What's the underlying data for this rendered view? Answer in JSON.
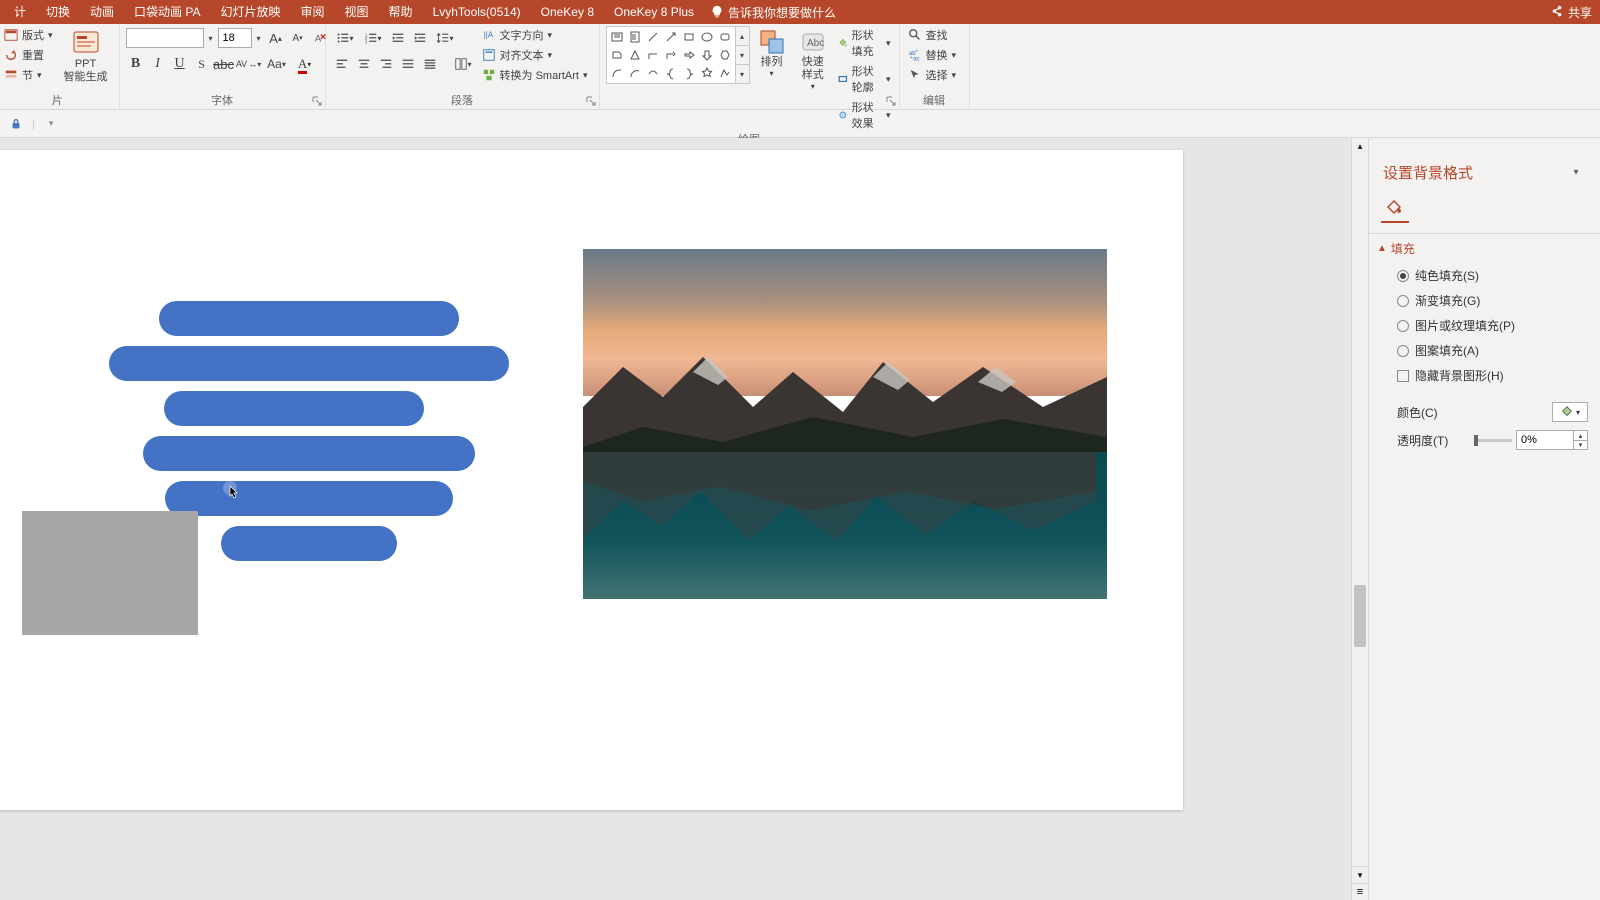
{
  "ribbon_tabs": {
    "design": "计",
    "transitions": "切换",
    "animations": "动画",
    "pocket_anim": "口袋动画 PA",
    "slideshow": "幻灯片放映",
    "review": "审阅",
    "view": "视图",
    "help": "帮助",
    "lvyh": "LvyhTools(0514)",
    "onekey8": "OneKey 8",
    "onekey8plus": "OneKey 8 Plus",
    "tell_me": "告诉我你想要做什么",
    "share": "共享"
  },
  "ribbon": {
    "slides": {
      "layout": "版式",
      "reset": "重置",
      "section": "节",
      "ppt_ai": "PPT\n智能生成"
    },
    "font": {
      "size": "18",
      "label": "字体",
      "spacing": "AV",
      "aa": "Aa"
    },
    "paragraph": {
      "label": "段落",
      "direction": "文字方向",
      "align_text": "对齐文本",
      "smartart": "转换为 SmartArt"
    },
    "drawing": {
      "label": "绘图",
      "arrange": "排列",
      "quick_styles": "快速样式",
      "shape_fill": "形状填充",
      "shape_outline": "形状轮廓",
      "shape_effects": "形状效果"
    },
    "editing": {
      "label": "编辑",
      "find": "查找",
      "replace": "替换",
      "select": "选择"
    }
  },
  "side_pane": {
    "title": "设置背景格式",
    "fill_section": "填充",
    "solid": "纯色填充(S)",
    "gradient": "渐变填充(G)",
    "picture": "图片或纹理填充(P)",
    "pattern": "图案填充(A)",
    "hide_bg": "隐藏背景图形(H)",
    "color_label": "颜色(C)",
    "transparency_label": "透明度(T)",
    "transparency_value": "0%"
  }
}
